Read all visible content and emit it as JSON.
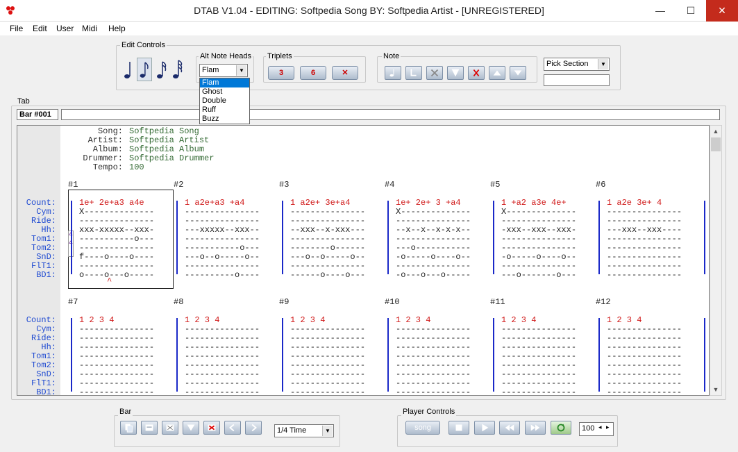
{
  "window": {
    "title": "DTAB V1.04 - EDITING: Softpedia Song   BY: Softpedia Artist - [UNREGISTERED]",
    "minimize": "—",
    "maximize": "☐",
    "close": "✕"
  },
  "menu": [
    "File",
    "Edit",
    "User",
    "Midi",
    "Help"
  ],
  "groups": {
    "edit_controls": "Edit Controls",
    "alt_note_heads": "Alt Note Heads",
    "triplets": "Triplets",
    "note": "Note",
    "tab": "Tab",
    "bar": "Bar",
    "player_controls": "Player Controls"
  },
  "alt_note_heads": {
    "selected": "Flam",
    "options": [
      "Flam",
      "Ghost",
      "Double",
      "Ruff",
      "Buzz"
    ]
  },
  "triplets": [
    "3",
    "6",
    "✕"
  ],
  "pick_section": {
    "selected": "Pick Section",
    "value": ""
  },
  "bar_label": "Bar #001",
  "song_info": {
    "keys": [
      "Song:",
      "Artist:",
      "Album:",
      "Drummer:",
      "Tempo:"
    ],
    "values": [
      "Softpedia Song",
      "Softpedia Artist",
      "Softpedia Album",
      "Softpedia Drummer",
      "100"
    ]
  },
  "lanes": [
    "Count:",
    "Cym:",
    "Ride:",
    "Hh:",
    "Tom1:",
    "Tom2:",
    "SnD:",
    "FlT1:",
    "BD1:"
  ],
  "time_sig": [
    "4",
    "4"
  ],
  "accent_mark": "^",
  "system1": {
    "measures": [
      "#1",
      "#2",
      "#3",
      "#4",
      "#5",
      "#6"
    ],
    "counts": [
      "1e+ 2e+a3  a4e",
      "1  a2e+a3 +a4",
      "1  a2e+ 3e+a4",
      "1e+ 2e+ 3 +a4",
      "1 +a2  a3e  4e+",
      "1  a2e  3e+ 4"
    ],
    "rows": [
      [
        "X--------------",
        "---------------",
        "---------------",
        "X--------------",
        "X--------------",
        "---------------"
      ],
      [
        "---------------",
        "---------------",
        "---------------",
        "---------------",
        "---------------",
        "---------------"
      ],
      [
        "xxx-xxxxx--xxx-",
        "---xxxxx--xxx--",
        "--xxx--x-xxx---",
        "--x--x--x-x-x--",
        "-xxx--xxx--xxx-",
        "---xxx--xxx----"
      ],
      [
        "-----------o---",
        "---------------",
        "---------------",
        "---------------",
        "---------------",
        "---------------"
      ],
      [
        "---------------",
        "-----------o---",
        "--------o------",
        "---o-----------",
        "---------------",
        "---------------"
      ],
      [
        "f----o----o----",
        "---o--o-----o--",
        "---o--o-----o--",
        "-o-----o----o--",
        "-o-----o----o--",
        "---------------"
      ],
      [
        "---------------",
        "---------------",
        "---------------",
        "---------------",
        "---------------",
        "---------------"
      ],
      [
        "o----o---o-----",
        "----------o----",
        "------o----o---",
        "-o---o---o-----",
        "---o-------o---",
        "---------------"
      ]
    ]
  },
  "system2": {
    "measures": [
      "#7",
      "#8",
      "#9",
      "#10",
      "#11",
      "#12"
    ],
    "counts": [
      "1   2   3   4",
      "1   2   3   4",
      "1   2   3   4",
      "1   2   3   4",
      "1   2   3   4",
      "1   2   3   4"
    ],
    "row": "---------------"
  },
  "bar_controls": {
    "time": "1/4 Time"
  },
  "player": {
    "song_label": "song",
    "tempo": "100"
  }
}
